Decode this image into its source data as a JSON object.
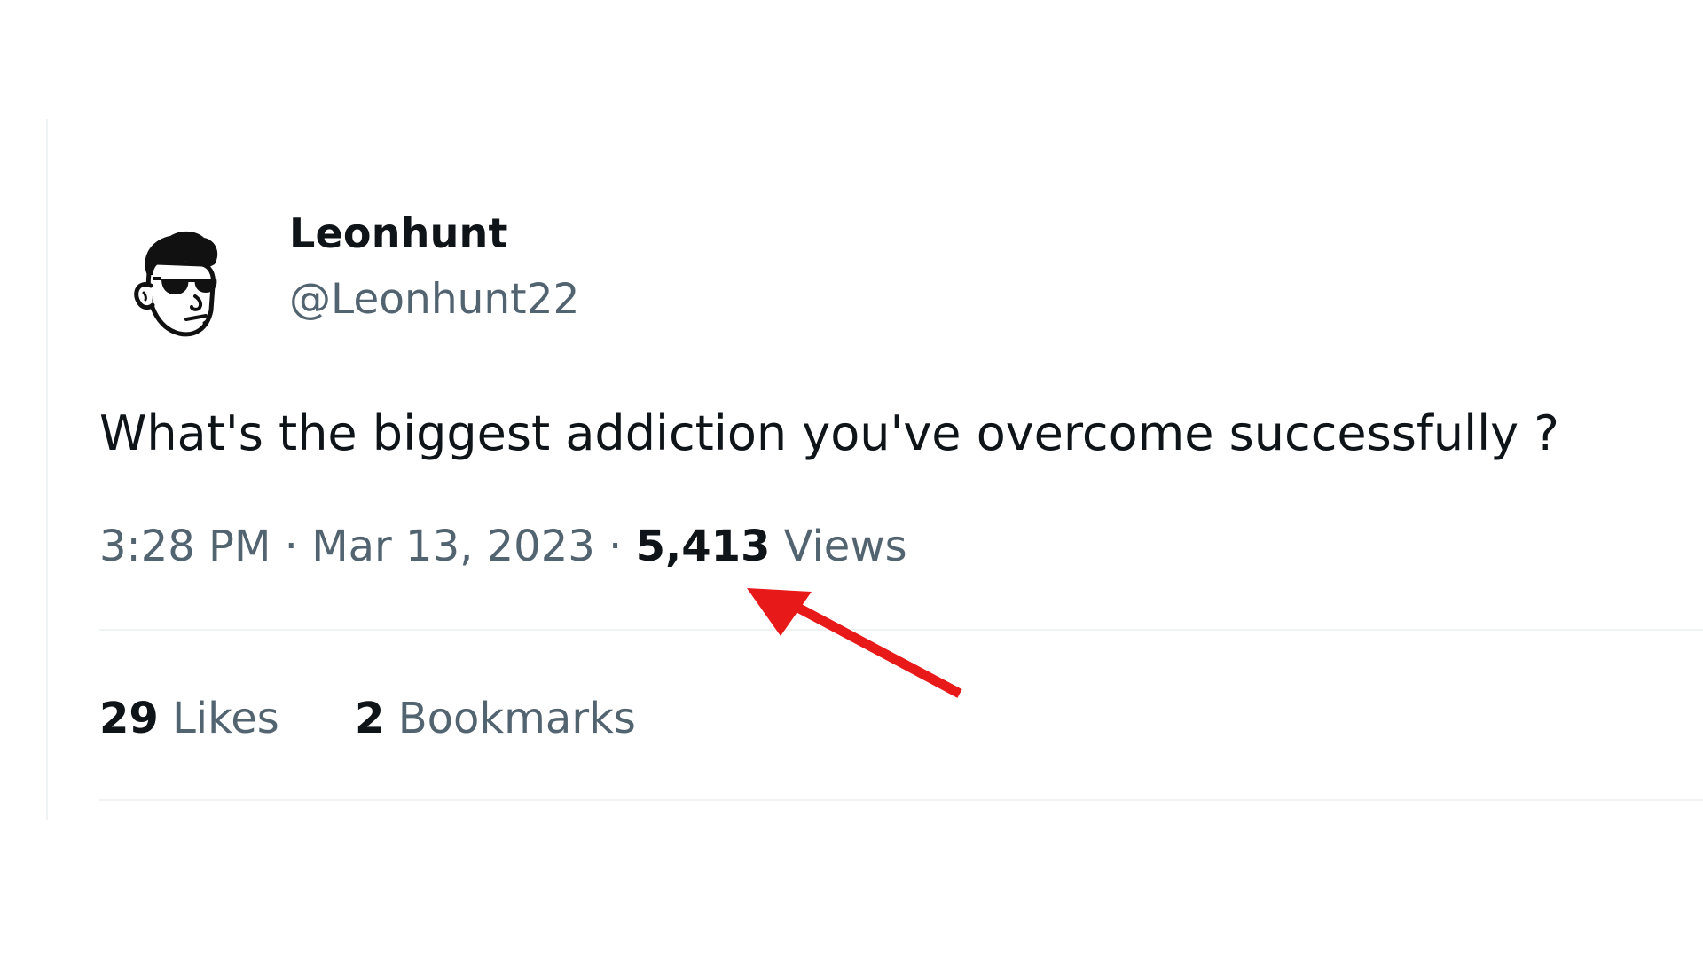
{
  "author": {
    "display_name": "Leonhunt",
    "handle": "@Leonhunt22"
  },
  "tweet": {
    "text": "What's the biggest addiction you've overcome successfully ?",
    "time": "3:28 PM",
    "separator": "·",
    "date": "Mar 13, 2023",
    "views_count": "5,413",
    "views_label": "Views"
  },
  "engagement": {
    "likes_count": "29",
    "likes_label": "Likes",
    "bookmarks_count": "2",
    "bookmarks_label": "Bookmarks"
  },
  "annotation": {
    "arrow_color": "#e81919"
  }
}
